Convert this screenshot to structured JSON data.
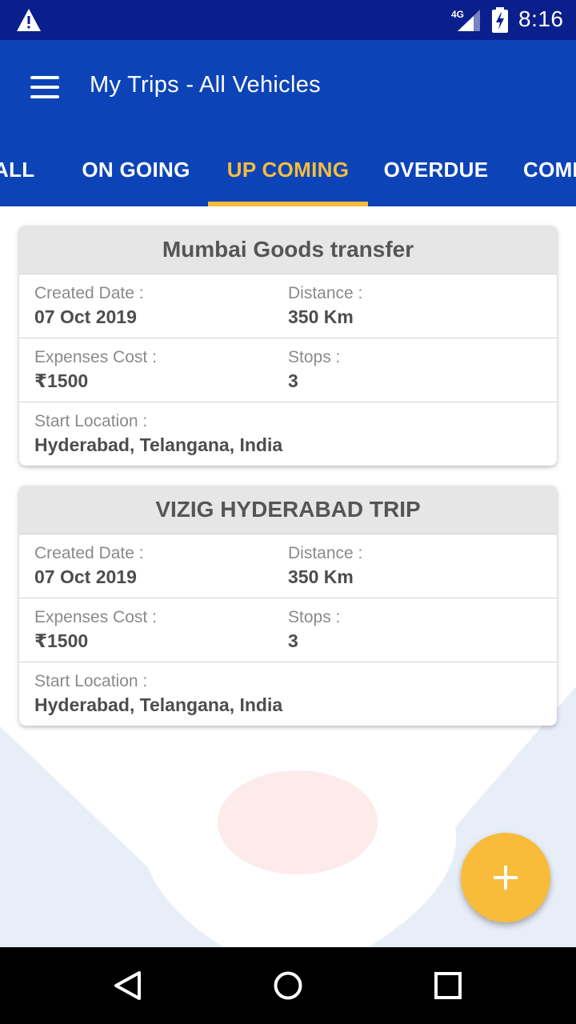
{
  "status_bar": {
    "time": "8:16",
    "network": "4G",
    "icons": [
      "warning-icon",
      "signal-icon",
      "battery-charging-icon"
    ]
  },
  "app_bar": {
    "menu_icon": "hamburger-menu-icon",
    "title": "My Trips - All Vehicles"
  },
  "tabs": [
    {
      "label": "ALL",
      "active": false
    },
    {
      "label": "ON GOING",
      "active": false
    },
    {
      "label": "UP COMING",
      "active": true
    },
    {
      "label": "OVERDUE",
      "active": false
    },
    {
      "label": "COMI",
      "active": false
    }
  ],
  "trips": [
    {
      "title": "Mumbai Goods transfer",
      "created_label": "Created Date :",
      "created_value": "07 Oct 2019",
      "distance_label": "Distance :",
      "distance_value": "350 Km",
      "expenses_label": "Expenses Cost :",
      "expenses_value": "₹1500",
      "stops_label": "Stops :",
      "stops_value": "3",
      "start_label": "Start Location :",
      "start_value": "Hyderabad, Telangana, India"
    },
    {
      "title": "VIZIG HYDERABAD TRIP",
      "created_label": "Created Date :",
      "created_value": "07 Oct 2019",
      "distance_label": "Distance :",
      "distance_value": "350 Km",
      "expenses_label": "Expenses Cost :",
      "expenses_value": "₹1500",
      "stops_label": "Stops :",
      "stops_value": "3",
      "start_label": "Start Location :",
      "start_value": "Hyderabad, Telangana, India"
    }
  ],
  "fab": {
    "icon": "plus-icon"
  },
  "nav_bar": {
    "icons": [
      "back-triangle-icon",
      "home-circle-icon",
      "recents-square-icon"
    ]
  },
  "colors": {
    "status_bar": "#0a1f8c",
    "app_bar": "#0c44b8",
    "accent": "#f5bd3c",
    "card_header": "#e6e6e6"
  }
}
